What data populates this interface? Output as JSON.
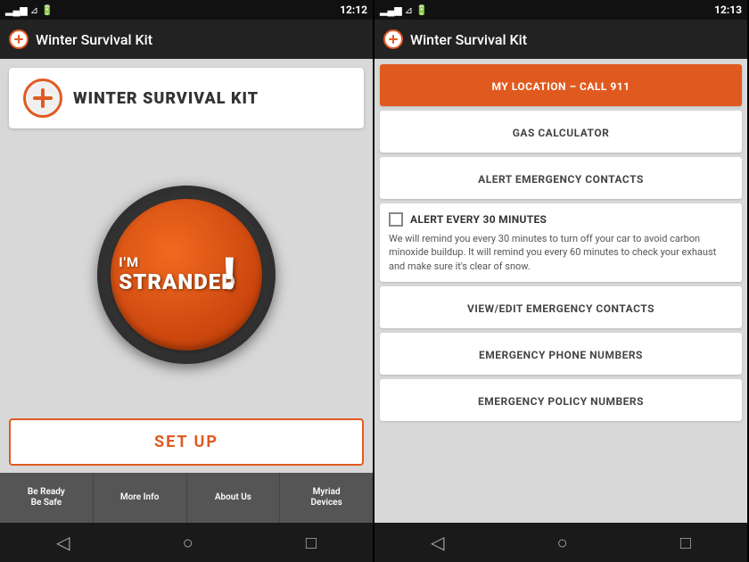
{
  "left_phone": {
    "status_bar": {
      "time": "12:12",
      "signal": "▂▄▆█",
      "battery": "⚡"
    },
    "top_bar": {
      "title": "Winter Survival Kit",
      "back_icon": "◀"
    },
    "logo": {
      "text": "WINTER SURVIVAL KIT"
    },
    "stranded_button": {
      "line1": "I'M",
      "line2": "STRANDED",
      "exclaim": "!"
    },
    "setup_button": {
      "label": "SET UP"
    },
    "bottom_tabs": [
      {
        "label": "Be Ready\nBe Safe"
      },
      {
        "label": "More Info"
      },
      {
        "label": "About Us"
      },
      {
        "label": "Myriad\nDevices"
      }
    ],
    "nav": {
      "back": "◁",
      "home": "○",
      "recent": "□"
    }
  },
  "right_phone": {
    "status_bar": {
      "time": "12:13",
      "signal": "▂▄▆█",
      "battery": "⚡"
    },
    "top_bar": {
      "title": "Winter Survival Kit",
      "back_icon": "◀"
    },
    "menu_items": [
      {
        "label": "MY LOCATION – CALL 911",
        "type": "orange"
      },
      {
        "label": "GAS CALCULATOR",
        "type": "normal"
      },
      {
        "label": "ALERT EMERGENCY CONTACTS",
        "type": "normal"
      }
    ],
    "alert_section": {
      "title": "ALERT EVERY 30 MINUTES",
      "description": "We will remind you every 30 minutes to turn off your car to avoid carbon minoxide buildup. It will remind you every 60 minutes to check your exhaust and make sure it's clear of snow."
    },
    "bottom_menu_items": [
      {
        "label": "VIEW/EDIT EMERGENCY CONTACTS"
      },
      {
        "label": "EMERGENCY PHONE NUMBERS"
      },
      {
        "label": "EMERGENCY POLICY NUMBERS"
      }
    ],
    "nav": {
      "back": "◁",
      "home": "○",
      "recent": "□"
    }
  }
}
